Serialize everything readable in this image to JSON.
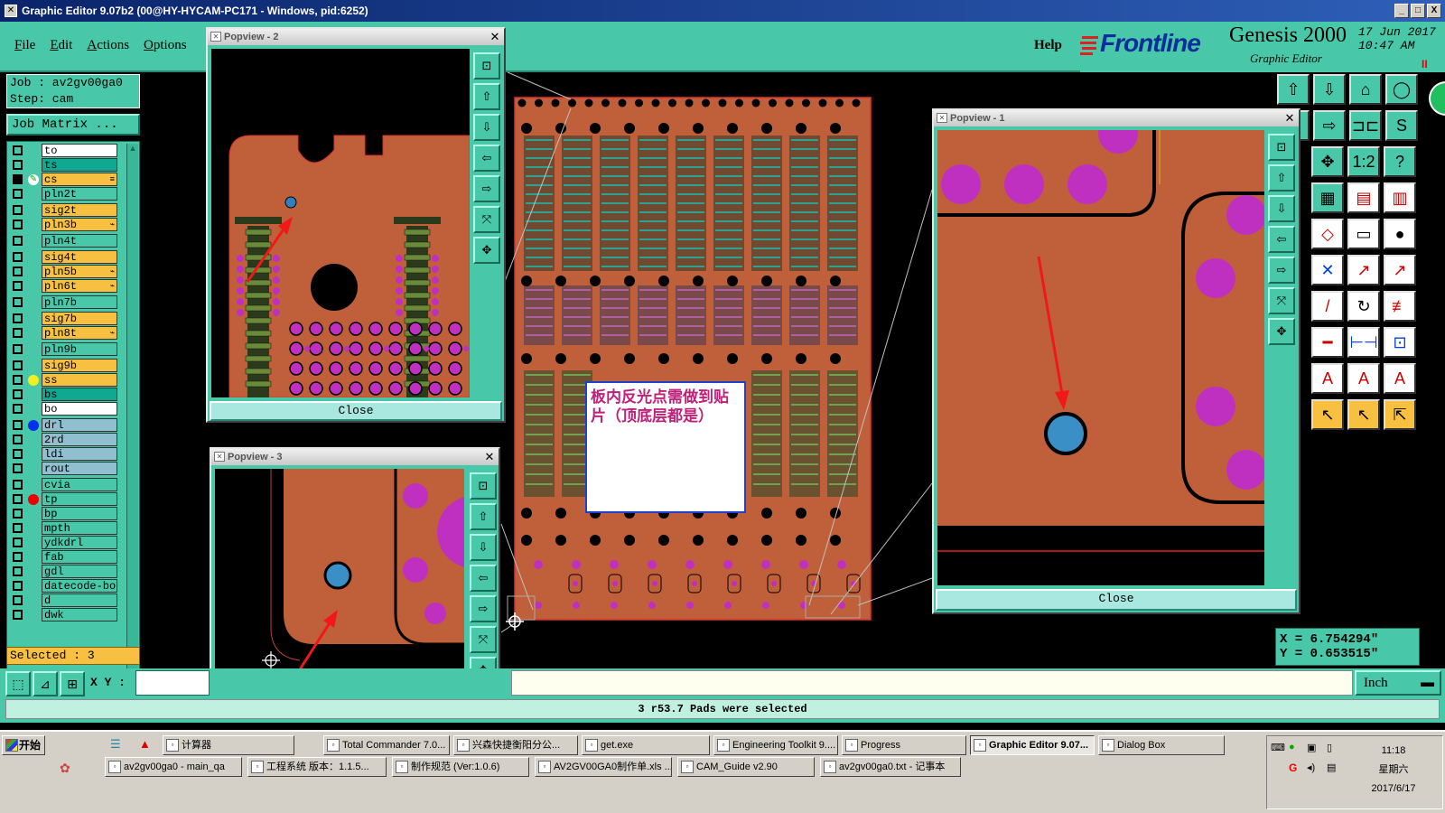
{
  "window": {
    "title": "Graphic Editor 9.07b2 (00@HY-HYCAM-PC171 - Windows, pid:6252)",
    "min": "_",
    "max": "□",
    "close": "X"
  },
  "menu": {
    "items": [
      "File",
      "Edit",
      "Actions",
      "Options"
    ],
    "help": "Help"
  },
  "brand": {
    "logo": "Frontline",
    "product": "Genesis 2000",
    "subtitle": "Graphic Editor",
    "date": "17 Jun 2017",
    "time": "10:47 AM",
    "pause": "II"
  },
  "job": {
    "job_line": "Job : av2gv00ga0",
    "step_line": "Step: cam",
    "matrix_button": "Job Matrix ..."
  },
  "layers": [
    {
      "name": "to",
      "color": "#ffffff",
      "dot": "",
      "mark": ""
    },
    {
      "name": "ts",
      "color": "#10a890",
      "dot": "",
      "mark": ""
    },
    {
      "name": "cs",
      "color": "#f8c040",
      "dot": "",
      "mark": "≡",
      "active": true
    },
    {
      "name": "pln2t",
      "color": "#48c8a8",
      "dot": "",
      "mark": ""
    },
    {
      "name": "sig2t",
      "color": "#f8c040",
      "dot": "",
      "mark": ""
    },
    {
      "name": "pln3b",
      "color": "#f8c040",
      "dot": "",
      "mark": "⌁"
    },
    {
      "name": "pln4t",
      "color": "#48c8a8",
      "dot": "",
      "mark": ""
    },
    {
      "name": "sig4t",
      "color": "#f8c040",
      "dot": "",
      "mark": ""
    },
    {
      "name": "pln5b",
      "color": "#f8c040",
      "dot": "",
      "mark": "⌁"
    },
    {
      "name": "pln6t",
      "color": "#f8c040",
      "dot": "",
      "mark": "⌁"
    },
    {
      "name": "pln7b",
      "color": "#48c8a8",
      "dot": "",
      "mark": ""
    },
    {
      "name": "sig7b",
      "color": "#f8c040",
      "dot": "",
      "mark": ""
    },
    {
      "name": "pln8t",
      "color": "#f8c040",
      "dot": "",
      "mark": "⌁"
    },
    {
      "name": "pln9b",
      "color": "#48c8a8",
      "dot": "",
      "mark": ""
    },
    {
      "name": "sig9b",
      "color": "#f8c040",
      "dot": "",
      "mark": ""
    },
    {
      "name": "ss",
      "color": "#f8c040",
      "dot": "#f0f020",
      "mark": ""
    },
    {
      "name": "bs",
      "color": "#10a890",
      "dot": "",
      "mark": ""
    },
    {
      "name": "bo",
      "color": "#ffffff",
      "dot": "",
      "mark": ""
    },
    {
      "name": "drl",
      "color": "#90c0d0",
      "dot": "#0030f0",
      "mark": ""
    },
    {
      "name": "2rd",
      "color": "#90c0d0",
      "dot": "",
      "mark": ""
    },
    {
      "name": "ldi",
      "color": "#90c0d0",
      "dot": "",
      "mark": ""
    },
    {
      "name": "rout",
      "color": "#90c0d0",
      "dot": "",
      "mark": ""
    },
    {
      "name": "cvia",
      "color": "#48c8a8",
      "dot": "",
      "mark": ""
    },
    {
      "name": "tp",
      "color": "#48c8a8",
      "dot": "#f00000",
      "mark": ""
    },
    {
      "name": "bp",
      "color": "#48c8a8",
      "dot": "",
      "mark": ""
    },
    {
      "name": "mpth",
      "color": "#48c8a8",
      "dot": "",
      "mark": ""
    },
    {
      "name": "ydkdrl",
      "color": "#48c8a8",
      "dot": "",
      "mark": ""
    },
    {
      "name": "fab",
      "color": "#48c8a8",
      "dot": "",
      "mark": ""
    },
    {
      "name": "gdl",
      "color": "#48c8a8",
      "dot": "",
      "mark": ""
    },
    {
      "name": "datecode-bo",
      "color": "#48c8a8",
      "dot": "",
      "mark": ""
    },
    {
      "name": "d",
      "color": "#48c8a8",
      "dot": "",
      "mark": ""
    },
    {
      "name": "dwk",
      "color": "#48c8a8",
      "dot": "",
      "mark": ""
    }
  ],
  "selected": "Selected : 3",
  "xy_label": "X Y :",
  "coords": {
    "x": "X = 6.754294\"",
    "y": "Y = 0.653515\""
  },
  "units": "Inch",
  "status_message": "3 r53.7 Pads were selected",
  "annotation": "板内反光点需做到贴片（顶底层都是）",
  "popups": {
    "p1_title": "Popview - 1",
    "p2_title": "Popview - 2",
    "p3_title": "Popview - 3",
    "close_label": "Close"
  },
  "taskbar": {
    "start": "开始",
    "row1": [
      {
        "label": "计算器",
        "icon": "calc"
      },
      {
        "label": "Total Commander 7.0...",
        "icon": "tc"
      },
      {
        "label": "兴森快捷衡阳分公...",
        "icon": "web"
      },
      {
        "label": "get.exe",
        "icon": "exe"
      },
      {
        "label": "Engineering Toolkit 9....",
        "icon": "gen"
      },
      {
        "label": "Progress",
        "icon": "gen"
      },
      {
        "label": "Graphic Editor 9.07...",
        "icon": "gen",
        "active": true
      },
      {
        "label": "Dialog Box",
        "icon": "gen"
      }
    ],
    "row2": [
      {
        "label": "av2gv00ga0 - main_qa",
        "icon": "gen"
      },
      {
        "label": "工程系统  版本：1.1.5...",
        "icon": "sys"
      },
      {
        "label": "制作规范 (Ver:1.0.6)",
        "icon": "doc"
      },
      {
        "label": "AV2GV00GA0制作单.xls ...",
        "icon": "xls"
      },
      {
        "label": "CAM_Guide v2.90",
        "icon": "cam"
      },
      {
        "label": "av2gv00ga0.txt - 记事本",
        "icon": "txt"
      }
    ],
    "clock_time": "11:18",
    "clock_day": "星期六",
    "clock_date": "2017/6/17"
  }
}
